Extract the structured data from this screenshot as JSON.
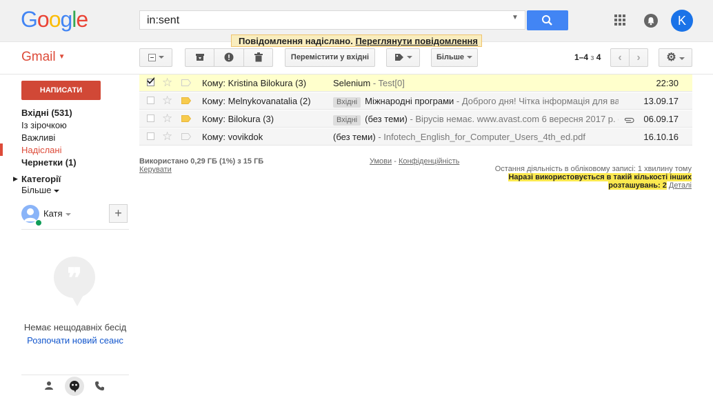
{
  "header": {
    "logo": [
      "G",
      "o",
      "o",
      "g",
      "l",
      "e"
    ],
    "logo_colors": [
      "#4285f4",
      "#ea4335",
      "#fbbc05",
      "#4285f4",
      "#34a853",
      "#ea4335"
    ],
    "search_value": "in:sent",
    "avatar_letter": "K"
  },
  "notice": {
    "text": "Повідомлення надіслано.",
    "link": "Переглянути повідомлення"
  },
  "app_label": "Gmail",
  "toolbar": {
    "move_inbox": "Перемістити у вхідні",
    "more": "Більше",
    "pager_range": "1–4",
    "pager_of": "з",
    "pager_total": "4"
  },
  "sidebar": {
    "compose": "НАПИСАТИ",
    "items": [
      {
        "label": "Вхідні (531)"
      },
      {
        "label": "Із зірочкою"
      },
      {
        "label": "Важливі"
      },
      {
        "label": "Надіслані"
      },
      {
        "label": "Чернетки (1)"
      },
      {
        "label": "Категорії"
      },
      {
        "label": "Більше"
      }
    ],
    "person": "Катя",
    "hangouts_empty": "Немає нещодавніх бесід",
    "hangouts_start": "Розпочати новий сеанс"
  },
  "messages": [
    {
      "from": "Кому: Kristina Bilokura (3)",
      "label": "",
      "subject": "Selenium",
      "snippet": " - Test[0]",
      "date": "22:30",
      "selected": true
    },
    {
      "from": "Кому: Melnykovanatalia (2)",
      "label": "Вхідні",
      "subject": "Міжнародні програми",
      "snippet": " - Доброго дня! Чітка інформація для ва",
      "date": "13.09.17"
    },
    {
      "from": "Кому: Bilokura (3)",
      "label": "Вхідні",
      "subject": "(без теми)",
      "snippet": " - Вірусів немає. www.avast.com 6 вересня 2017 р. о",
      "date": "06.09.17"
    },
    {
      "from": "Кому: vovikdok",
      "label": "",
      "subject": "(без теми)",
      "snippet": " - Infotech_English_for_Computer_Users_4th_ed.pdf",
      "date": "16.10.16"
    }
  ],
  "footer": {
    "usage": "Використано 0,29 ГБ (1%) з 15 ГБ",
    "manage": "Керувати",
    "terms": "Умови",
    "terms_sep": " - ",
    "privacy": "Конфіденційність",
    "activity": "Остання діяльність в обліковому записі: 1 хвилину тому",
    "warning": "Наразі використовується в такій кількості інших розташувань: 2",
    "details": "Деталі"
  }
}
